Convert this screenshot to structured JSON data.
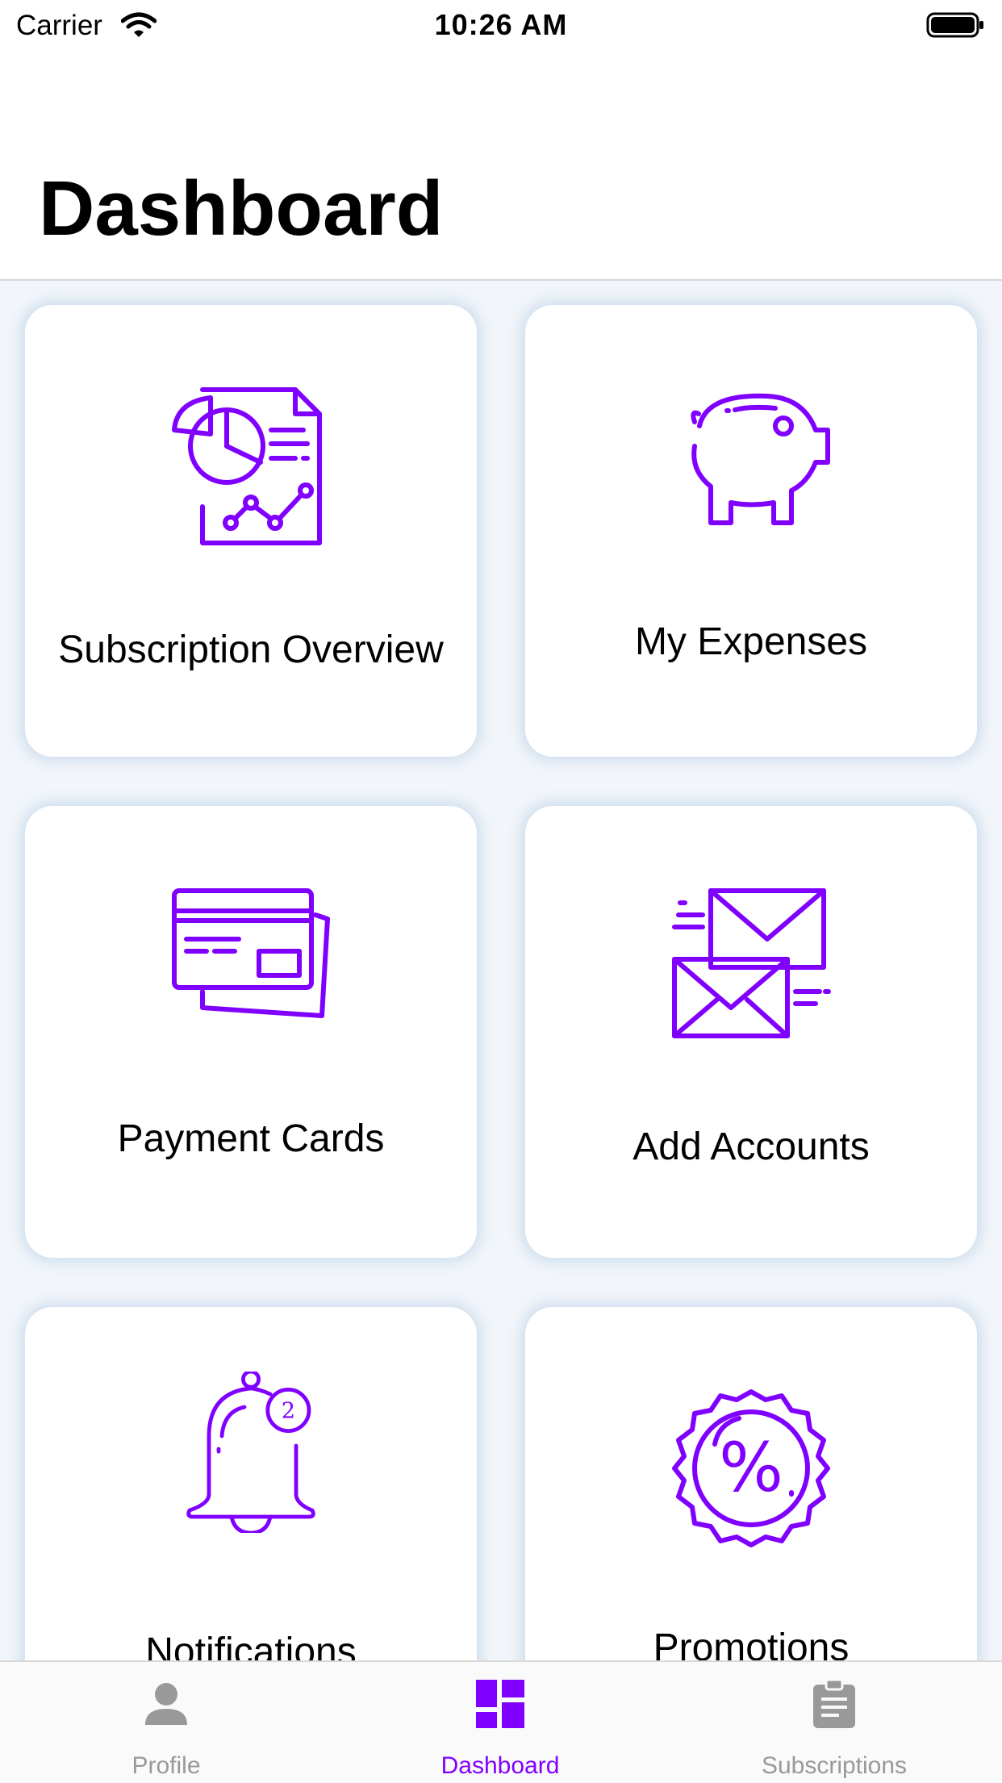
{
  "status_bar": {
    "carrier": "Carrier",
    "time": "10:26 AM",
    "wifi_icon": "wifi-icon",
    "battery_icon": "battery-full-icon"
  },
  "header": {
    "title": "Dashboard"
  },
  "tiles": [
    {
      "label": "Subscription Overview",
      "icon": "report-chart-icon"
    },
    {
      "label": "My Expenses",
      "icon": "piggy-bank-icon"
    },
    {
      "label": "Payment Cards",
      "icon": "credit-cards-icon"
    },
    {
      "label": "Add Accounts",
      "icon": "envelopes-icon"
    },
    {
      "label": "Notifications",
      "icon": "bell-badge-icon",
      "badge": "2"
    },
    {
      "label": "Promotions",
      "icon": "discount-badge-icon",
      "symbol": "%"
    }
  ],
  "tab_bar": {
    "tabs": [
      {
        "label": "Profile",
        "icon": "person-icon",
        "selected": false
      },
      {
        "label": "Dashboard",
        "icon": "dashboard-grid-icon",
        "selected": true
      },
      {
        "label": "Subscriptions",
        "icon": "clipboard-icon",
        "selected": false
      }
    ]
  },
  "colors": {
    "accent": "#8000ff",
    "tab_inactive": "#999999",
    "background": "#f2f6fa",
    "tile_background": "#ffffff"
  }
}
